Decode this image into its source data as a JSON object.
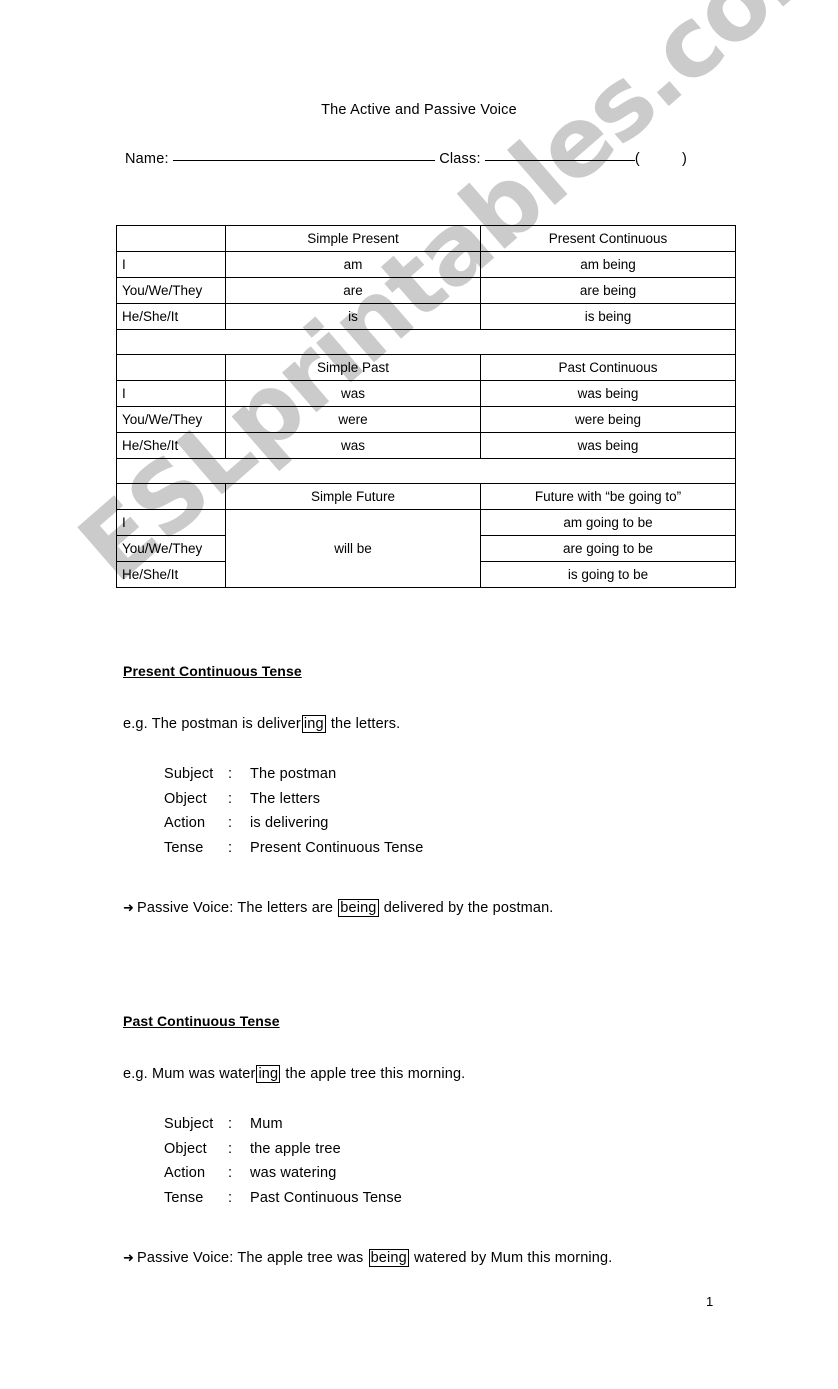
{
  "document": {
    "title": "The Active and Passive Voice",
    "page_number": "1",
    "watermark": "ESLprintables.com",
    "watermark_color": "#c9c9c9"
  },
  "name_line": {
    "name_label": "Name:",
    "class_label": "Class:",
    "open_paren": "(",
    "close_paren": ")"
  },
  "tables": [
    {
      "headers": [
        "",
        "Simple Present",
        "Present Continuous"
      ],
      "rows": [
        [
          "I",
          "am",
          "am being"
        ],
        [
          "You/We/They",
          "are",
          "are being"
        ],
        [
          "He/She/It",
          "is",
          "is being"
        ]
      ]
    },
    {
      "headers": [
        "",
        "Simple Past",
        "Past Continuous"
      ],
      "rows": [
        [
          "I",
          "was",
          "was being"
        ],
        [
          "You/We/They",
          "were",
          "were being"
        ],
        [
          "He/She/It",
          "was",
          "was being"
        ]
      ]
    },
    {
      "headers": [
        "",
        "Simple Future",
        "Future with “be going to”"
      ],
      "merged_middle": "will be",
      "rows": [
        [
          "I",
          "",
          "am going to be"
        ],
        [
          "You/We/They",
          "",
          "are going to be"
        ],
        [
          "He/She/It",
          "",
          "is going to be"
        ]
      ]
    }
  ],
  "sections": [
    {
      "title": "Present Continuous Tense",
      "example": {
        "prefix": "e.g. The postman is deliver",
        "boxed": "ing",
        "suffix": " the letters."
      },
      "breakdown": [
        {
          "label": "Subject",
          "colon": ":",
          "value": "The postman"
        },
        {
          "label": "Object",
          "colon": ":",
          "value": "The letters"
        },
        {
          "label": "Action",
          "colon": ":",
          "value": "is delivering"
        },
        {
          "label": "Tense",
          "colon": ":",
          "value": "Present Continuous Tense"
        }
      ],
      "passive": {
        "arrow": "➜",
        "prefix": "Passive Voice: The letters are ",
        "boxed": "being",
        "suffix": " delivered by the postman."
      }
    },
    {
      "title": "Past Continuous Tense",
      "example": {
        "prefix": "e.g. Mum was water",
        "boxed": "ing",
        "suffix": " the apple tree this morning."
      },
      "breakdown": [
        {
          "label": "Subject",
          "colon": ":",
          "value": "Mum"
        },
        {
          "label": "Object",
          "colon": ":",
          "value": "the apple tree"
        },
        {
          "label": "Action",
          "colon": ":",
          "value": "was watering"
        },
        {
          "label": "Tense",
          "colon": ":",
          "value": "Past Continuous Tense"
        }
      ],
      "passive": {
        "arrow": "➜",
        "prefix": "Passive Voice: The apple tree was ",
        "boxed": "being",
        "suffix": " watered by Mum this morning."
      }
    }
  ]
}
